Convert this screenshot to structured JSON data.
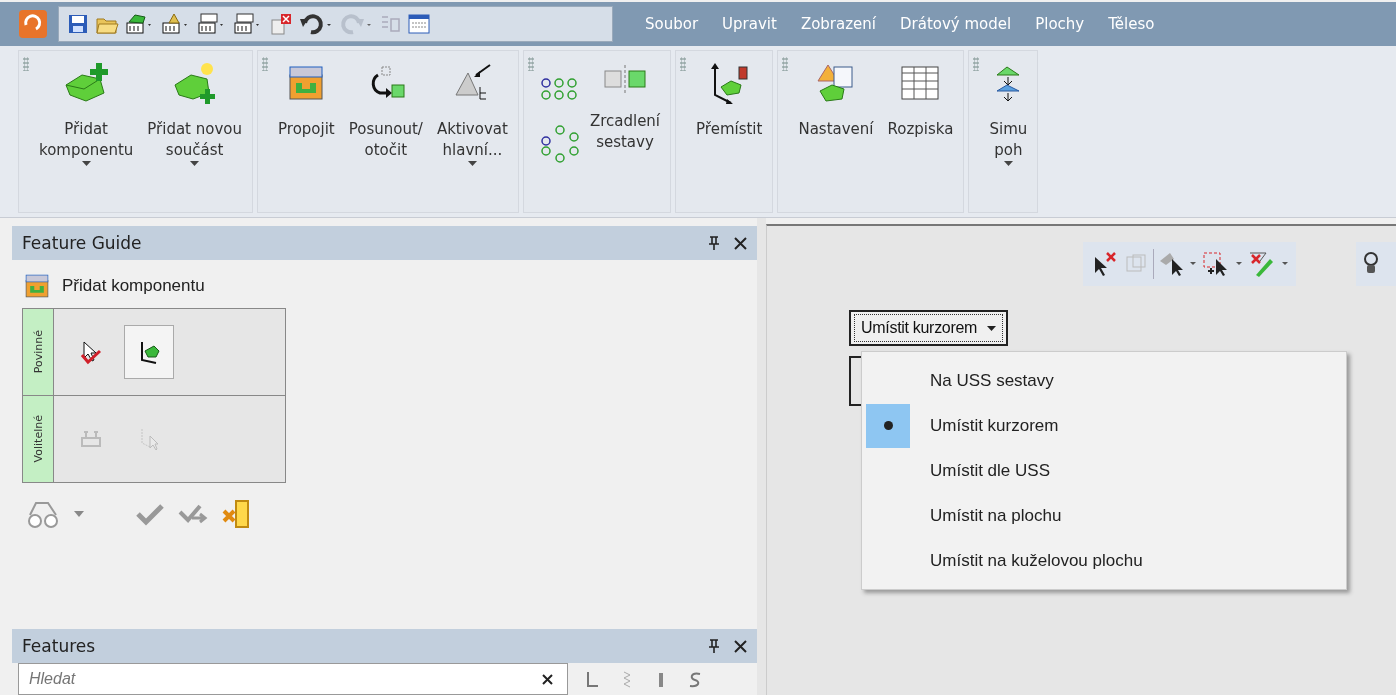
{
  "menu": [
    "Soubor",
    "Upravit",
    "Zobrazení",
    "Drátový model",
    "Plochy",
    "Těleso"
  ],
  "ribbon": [
    {
      "buttons": [
        {
          "kind": "add-component",
          "lines": [
            "Přidat",
            "komponentu"
          ],
          "dropdown": true
        },
        {
          "kind": "new-part",
          "lines": [
            "Přidat novou",
            "součást"
          ],
          "dropdown": true
        }
      ]
    },
    {
      "buttons": [
        {
          "kind": "link",
          "lines": [
            "Propojit"
          ],
          "dropdown": false
        },
        {
          "kind": "move",
          "lines": [
            "Posunout/",
            "otočit"
          ],
          "dropdown": false
        },
        {
          "kind": "activate",
          "lines": [
            "Aktivovat",
            "hlavní..."
          ],
          "dropdown": true
        }
      ]
    },
    {
      "buttons": [
        {
          "kind": "pattern"
        },
        {
          "kind": "mirror",
          "lines": [
            "Zrcadlení",
            "sestavy"
          ],
          "dropdown": false
        }
      ]
    },
    {
      "buttons": [
        {
          "kind": "relocate",
          "lines": [
            "Přemístit"
          ],
          "dropdown": false
        }
      ]
    },
    {
      "buttons": [
        {
          "kind": "settings",
          "lines": [
            "Nastavení"
          ],
          "dropdown": false
        },
        {
          "kind": "bom",
          "lines": [
            "Rozpiska"
          ],
          "dropdown": false
        }
      ]
    },
    {
      "buttons": [
        {
          "kind": "simulate",
          "lines": [
            "Simu",
            "poh"
          ],
          "dropdown": true
        }
      ]
    }
  ],
  "feature_guide": {
    "title": "Feature Guide",
    "step": "Přidat komponentu",
    "sections": [
      {
        "label": "Povinné",
        "disabled": false,
        "items": [
          {
            "kind": "pick",
            "selected": false
          },
          {
            "kind": "place",
            "selected": true
          }
        ]
      },
      {
        "label": "Volitelné",
        "disabled": true,
        "items": [
          {
            "kind": "constraint",
            "selected": false
          },
          {
            "kind": "axis-pick",
            "selected": false
          }
        ]
      }
    ]
  },
  "features": {
    "title": "Features",
    "search": {
      "placeholder": "Hledat"
    }
  },
  "placement": {
    "value": "Umístit kurzorem",
    "options": [
      {
        "label": "Na USS sestavy",
        "selected": false
      },
      {
        "label": "Umístit kurzorem",
        "selected": true
      },
      {
        "label": "Umístit dle USS",
        "selected": false
      },
      {
        "label": "Umístit na plochu",
        "selected": false
      },
      {
        "label": "Umístit na kuželovou plochu",
        "selected": false
      }
    ]
  }
}
